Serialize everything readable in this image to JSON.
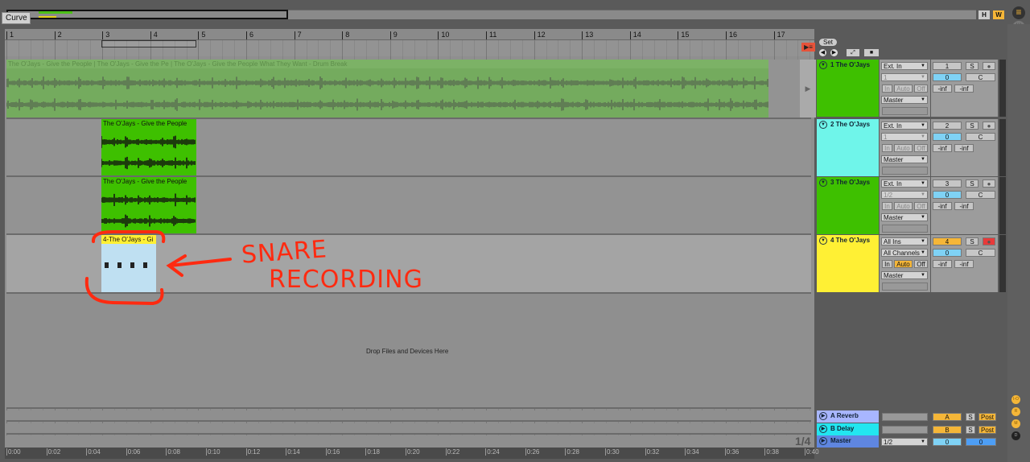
{
  "overview": {
    "curve_label": "Curve",
    "h_button": "H",
    "w_button": "W"
  },
  "ruler": {
    "bars": [
      "1",
      "2",
      "3",
      "4",
      "5",
      "6",
      "7",
      "8",
      "9",
      "10",
      "11",
      "12",
      "13",
      "14",
      "15",
      "16",
      "17"
    ]
  },
  "time_ruler": {
    "labels": [
      "0:00",
      "0:02",
      "0:04",
      "0:06",
      "0:08",
      "0:10",
      "0:12",
      "0:14",
      "0:16",
      "0:18",
      "0:20",
      "0:22",
      "0:24",
      "0:26",
      "0:28",
      "0:30",
      "0:32",
      "0:34",
      "0:36",
      "0:38",
      "0:40"
    ]
  },
  "set_controls": {
    "set_label": "Set"
  },
  "grid": "1/4",
  "drop_hint": "Drop Files and Devices Here",
  "tracks": [
    {
      "name": "1 The O'Jays",
      "color": "#3ec000",
      "input": "Ext. In",
      "channel": "1",
      "monitor": [
        "In",
        "Auto",
        "Off"
      ],
      "output": "Master",
      "number": "1",
      "solo": "S",
      "volume": "0",
      "pan": "C",
      "meter_l": "-inf",
      "meter_r": "-inf",
      "clips": [
        "The O'Jays - Give the People",
        "The O'Jays - Give the Pe",
        "The O'Jays - Give the People What They Want - Drum Break"
      ]
    },
    {
      "name": "2 The O'Jays",
      "color": "#6ff5ea",
      "input": "Ext. In",
      "channel": "1",
      "monitor": [
        "In",
        "Auto",
        "Off"
      ],
      "output": "Master",
      "number": "2",
      "solo": "S",
      "volume": "0",
      "pan": "C",
      "meter_l": "-inf",
      "meter_r": "-inf",
      "clips": [
        "The O'Jays - Give the People"
      ]
    },
    {
      "name": "3 The O'Jays",
      "color": "#3ec000",
      "input": "Ext. In",
      "channel": "1/2",
      "monitor": [
        "In",
        "Auto",
        "Off"
      ],
      "output": "Master",
      "number": "3",
      "solo": "S",
      "volume": "0",
      "pan": "C",
      "meter_l": "-inf",
      "meter_r": "-inf",
      "clips": [
        "The O'Jays - Give the People"
      ]
    },
    {
      "name": "4 The O'Jays",
      "color": "#fff034",
      "input": "All Ins",
      "channel": "All Channels",
      "monitor": [
        "In",
        "Auto",
        "Off"
      ],
      "output": "Master",
      "number": "4",
      "solo": "S",
      "volume": "0",
      "pan": "C",
      "meter_l": "-inf",
      "meter_r": "-inf",
      "armed": true,
      "clips": [
        "4-The O'Jays - Gi"
      ]
    }
  ],
  "returns": [
    {
      "name": "A Reverb",
      "color": "#a8b6ff",
      "send": "A",
      "solo": "S",
      "post": "Post"
    },
    {
      "name": "B Delay",
      "color": "#22e6f0",
      "send": "B",
      "solo": "S",
      "post": "Post"
    }
  ],
  "master": {
    "name": "Master",
    "color": "#5f86e0",
    "cue": "1/2",
    "volume": "0",
    "cue_volume": "0"
  },
  "side_buttons": [
    "I-O",
    "R",
    "M",
    "D"
  ],
  "annotation": {
    "line1": "SNARE",
    "line2": "RECORDING",
    "color": "#ff2a10"
  }
}
